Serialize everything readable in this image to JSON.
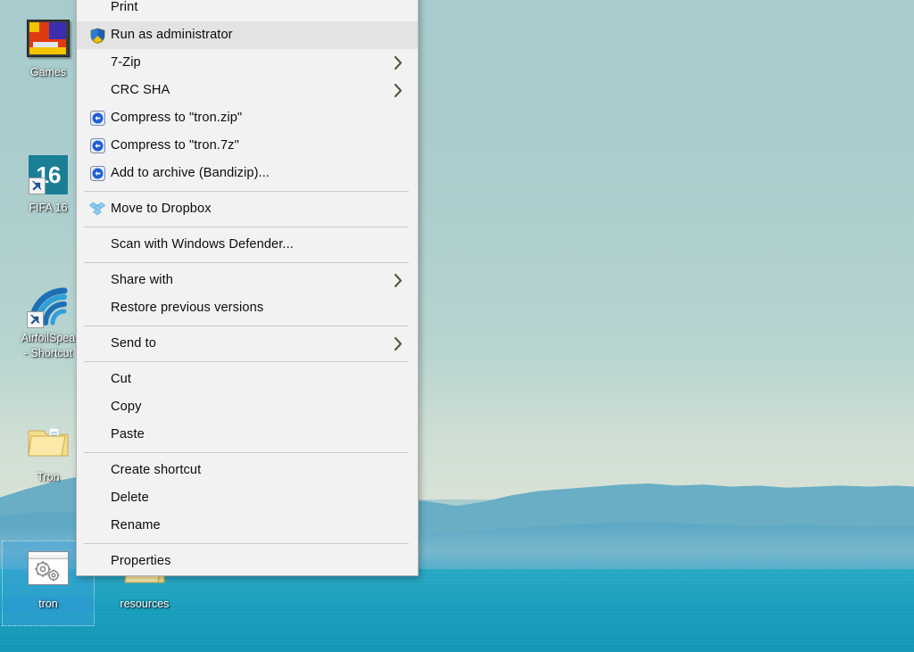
{
  "desktop": {
    "wallpaper_description": "Lake with blue mountain ranges under pale cyan sky",
    "colors": {
      "sky": "#a9ccce",
      "mountain_far": "#69aec4",
      "mountain_mid": "#5ea8c4",
      "water": "#1b9fbe",
      "selection": "#3ca0dc",
      "menu_background": "#f2f2f2",
      "menu_border": "#b4b4b4",
      "menu_highlight": "#e3e3e3",
      "separator": "#c9c9c9"
    },
    "icons": [
      {
        "id": "games",
        "label": "Games",
        "icon": "games-tiles-icon",
        "shortcut": false,
        "selected": false
      },
      {
        "id": "fifa16",
        "label": "FIFA 16",
        "icon": "fifa-16-icon",
        "badge": "16",
        "shortcut": true,
        "selected": false
      },
      {
        "id": "airfoil",
        "label": "AirfoilSpea\n- Shortcut",
        "label_line1": "AirfoilSpea",
        "label_line2": "- Shortcut",
        "icon": "airfoil-speakers-icon",
        "shortcut": true,
        "selected": false
      },
      {
        "id": "tron-folder",
        "label": "Tron",
        "icon": "folder-icon",
        "shortcut": false,
        "selected": false
      },
      {
        "id": "tron-bat",
        "label": "tron",
        "icon": "batch-script-icon",
        "shortcut": false,
        "selected": true
      },
      {
        "id": "resources",
        "label": "resources",
        "icon": "folder-icon",
        "shortcut": false,
        "selected": false
      }
    ]
  },
  "context_menu": {
    "target_file": "tron",
    "items": [
      {
        "type": "item",
        "label": "Print",
        "icon": null,
        "submenu": false,
        "highlight": false,
        "clipped": true
      },
      {
        "type": "item",
        "label": "Run as administrator",
        "icon": "uac-shield-icon",
        "submenu": false,
        "highlight": true
      },
      {
        "type": "item",
        "label": "7-Zip",
        "icon": null,
        "submenu": true,
        "highlight": false
      },
      {
        "type": "item",
        "label": "CRC SHA",
        "icon": null,
        "submenu": true,
        "highlight": false
      },
      {
        "type": "item",
        "label": "Compress to \"tron.zip\"",
        "icon": "bandizip-icon",
        "submenu": false,
        "highlight": false
      },
      {
        "type": "item",
        "label": "Compress to \"tron.7z\"",
        "icon": "bandizip-icon",
        "submenu": false,
        "highlight": false
      },
      {
        "type": "item",
        "label": "Add to archive (Bandizip)...",
        "icon": "bandizip-icon",
        "submenu": false,
        "highlight": false
      },
      {
        "type": "separator"
      },
      {
        "type": "item",
        "label": "Move to Dropbox",
        "icon": "dropbox-icon",
        "submenu": false,
        "highlight": false
      },
      {
        "type": "separator"
      },
      {
        "type": "item",
        "label": "Scan with Windows Defender...",
        "icon": null,
        "submenu": false,
        "highlight": false
      },
      {
        "type": "separator"
      },
      {
        "type": "item",
        "label": "Share with",
        "icon": null,
        "submenu": true,
        "highlight": false
      },
      {
        "type": "item",
        "label": "Restore previous versions",
        "icon": null,
        "submenu": false,
        "highlight": false
      },
      {
        "type": "separator"
      },
      {
        "type": "item",
        "label": "Send to",
        "icon": null,
        "submenu": true,
        "highlight": false
      },
      {
        "type": "separator"
      },
      {
        "type": "item",
        "label": "Cut",
        "icon": null,
        "submenu": false,
        "highlight": false
      },
      {
        "type": "item",
        "label": "Copy",
        "icon": null,
        "submenu": false,
        "highlight": false
      },
      {
        "type": "item",
        "label": "Paste",
        "icon": null,
        "submenu": false,
        "highlight": false
      },
      {
        "type": "separator"
      },
      {
        "type": "item",
        "label": "Create shortcut",
        "icon": null,
        "submenu": false,
        "highlight": false
      },
      {
        "type": "item",
        "label": "Delete",
        "icon": null,
        "submenu": false,
        "highlight": false
      },
      {
        "type": "item",
        "label": "Rename",
        "icon": null,
        "submenu": false,
        "highlight": false
      },
      {
        "type": "separator"
      },
      {
        "type": "item",
        "label": "Properties",
        "icon": null,
        "submenu": false,
        "highlight": false
      }
    ]
  }
}
